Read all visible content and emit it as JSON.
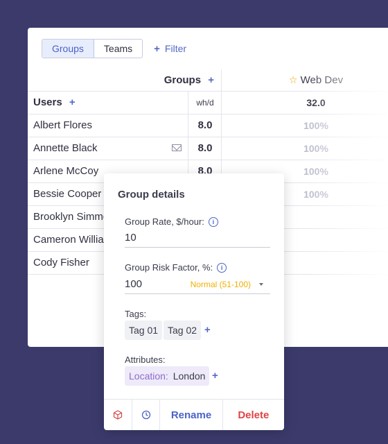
{
  "toolbar": {
    "tabs": [
      "Groups",
      "Teams"
    ],
    "filter_label": "Filter"
  },
  "table": {
    "groups_header": "Groups",
    "users_header": "Users",
    "wh_header": "wh/d",
    "group_name": "Web Dev",
    "group_total": "32.0",
    "rows": [
      {
        "name": "Albert Flores",
        "wh": "8.0",
        "pct": "100%"
      },
      {
        "name": "Annette Black",
        "wh": "8.0",
        "pct": "100%"
      },
      {
        "name": "Arlene McCoy",
        "wh": "8.0",
        "pct": "100%"
      },
      {
        "name": "Bessie Cooper",
        "wh": "",
        "pct": "100%"
      },
      {
        "name": "Brooklyn Simmons",
        "wh": "",
        "pct": ""
      },
      {
        "name": "Cameron Williamson",
        "wh": "",
        "pct": ""
      },
      {
        "name": "Cody Fisher",
        "wh": "",
        "pct": ""
      }
    ]
  },
  "popup": {
    "title": "Group details",
    "rate_label": "Group Rate, $/hour:",
    "rate_value": "10",
    "risk_label": "Group Risk Factor, %:",
    "risk_value": "100",
    "risk_level": "Normal (51-100)",
    "tags_label": "Tags:",
    "tags": [
      "Tag 01",
      "Tag 02"
    ],
    "attributes_label": "Attributes:",
    "attribute_key": "Location:",
    "attribute_value": "London",
    "rename_label": "Rename",
    "delete_label": "Delete"
  },
  "colors": {
    "background": "#3b3a6b",
    "accent": "#5468c7",
    "delete": "#e04343",
    "warning": "#f0b000"
  }
}
